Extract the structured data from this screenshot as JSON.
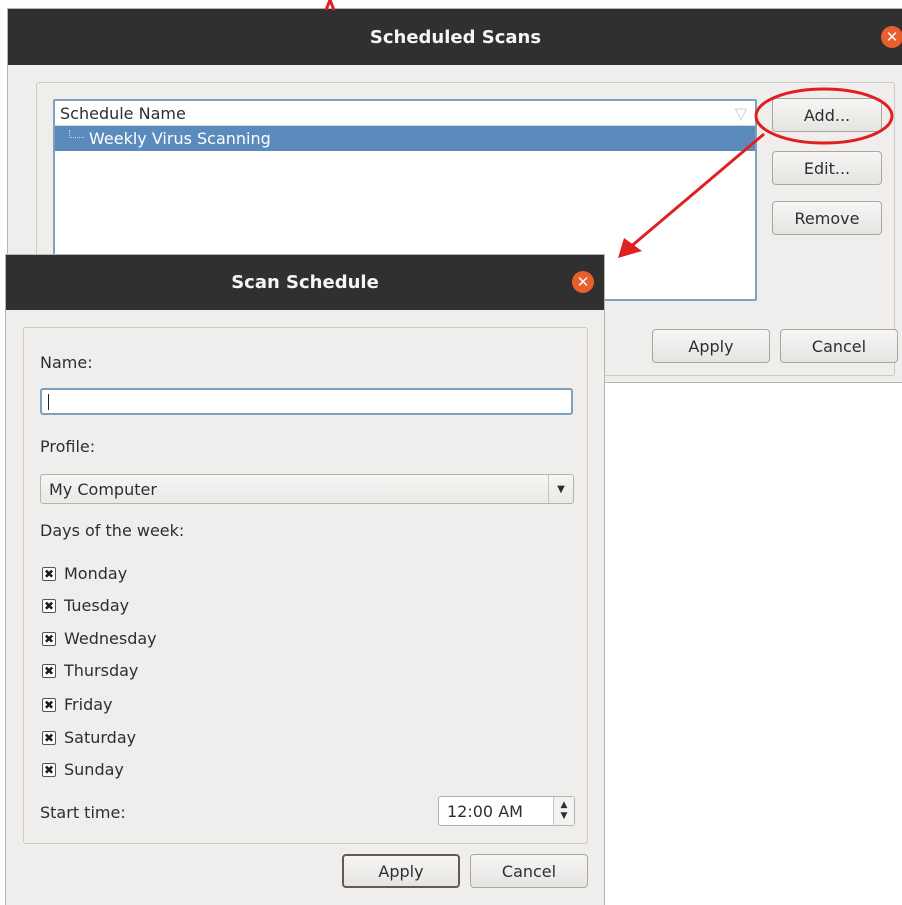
{
  "scheduled_scans": {
    "title": "Scheduled Scans",
    "close_glyph": "✕",
    "list_header": "Schedule Name",
    "items": [
      {
        "label": "Weekly Virus Scanning",
        "selected": true
      }
    ],
    "buttons": {
      "add": "Add...",
      "edit": "Edit...",
      "remove": "Remove",
      "apply": "Apply",
      "cancel": "Cancel"
    }
  },
  "scan_schedule": {
    "title": "Scan Schedule",
    "close_glyph": "✕",
    "name_label": "Name:",
    "name_value": "",
    "profile_label": "Profile:",
    "profile_value": "My Computer",
    "days_label": "Days of the week:",
    "days": [
      {
        "label": "Monday",
        "checked": true
      },
      {
        "label": "Tuesday",
        "checked": true
      },
      {
        "label": "Wednesday",
        "checked": true
      },
      {
        "label": "Thursday",
        "checked": true
      },
      {
        "label": "Friday",
        "checked": true
      },
      {
        "label": "Saturday",
        "checked": true
      },
      {
        "label": "Sunday",
        "checked": true
      }
    ],
    "check_glyph": "✖",
    "start_time_label": "Start time:",
    "start_time_value": "12:00 AM",
    "buttons": {
      "apply": "Apply",
      "cancel": "Cancel"
    }
  },
  "colors": {
    "titlebar": "#303030",
    "close_button": "#e85e2c",
    "selection": "#5b8bbd",
    "annotation": "#e02020"
  },
  "icons": [
    "close-icon",
    "sort-triangle-icon",
    "tree-branch-icon",
    "checkbox-check-icon",
    "dropdown-arrow-icon",
    "spin-up-icon",
    "spin-down-icon"
  ]
}
